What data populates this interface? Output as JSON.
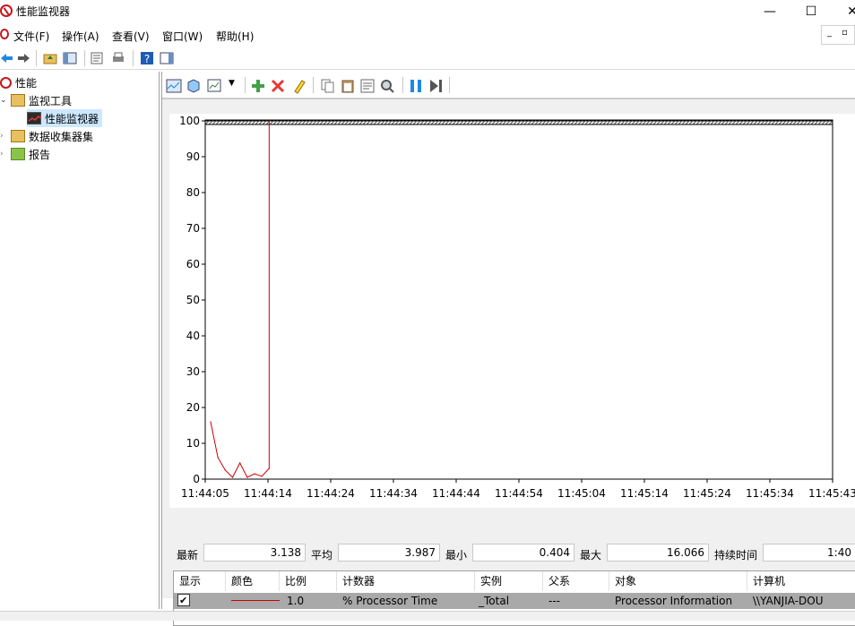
{
  "window": {
    "title": "性能监视器",
    "minimize": "—",
    "maximize": "☐",
    "close": "✕"
  },
  "menu": {
    "items": [
      "文件(F)",
      "操作(A)",
      "查看(V)",
      "窗口(W)",
      "帮助(H)"
    ]
  },
  "tree": {
    "items": [
      {
        "label": "性能",
        "icon": "performance-icon"
      },
      {
        "label": "监视工具",
        "icon": "folder-icon"
      },
      {
        "label": "性能监视器",
        "icon": "monitor-chart-icon"
      },
      {
        "label": "数据收集器集",
        "icon": "folder-icon"
      },
      {
        "label": "报告",
        "icon": "report-icon"
      }
    ]
  },
  "stats": {
    "last_label": "最新",
    "last_value": "3.138",
    "avg_label": "平均",
    "avg_value": "3.987",
    "min_label": "最小",
    "min_value": "0.404",
    "max_label": "最大",
    "max_value": "16.066",
    "duration_label": "持续时间",
    "duration_value": "1:40"
  },
  "table": {
    "headers": [
      "显示",
      "颜色",
      "比例",
      "计数器",
      "实例",
      "父系",
      "对象",
      "计算机"
    ],
    "rows": [
      {
        "show": "✔",
        "scale": "1.0",
        "counter": "% Processor Time",
        "instance": "_Total",
        "parent": "---",
        "object": "Processor Information",
        "computer": "\\\\YANJIA-DOU"
      }
    ]
  },
  "colors": {
    "line": "#cc0000",
    "selected_row": "#a9a9a9",
    "tree_selected": "#cce8ff"
  },
  "chart_data": {
    "type": "line",
    "ylim": [
      0,
      100
    ],
    "yticks": [
      0,
      10,
      20,
      30,
      40,
      50,
      60,
      70,
      80,
      90,
      100
    ],
    "xticks": [
      "11:44:05",
      "11:44:14",
      "11:44:24",
      "11:44:34",
      "11:44:44",
      "11:44:54",
      "11:45:04",
      "11:45:14",
      "11:45:24",
      "11:45:34",
      "11:45:43"
    ],
    "series": [
      {
        "values": [
          16,
          6,
          2.5,
          0.5,
          4.5,
          0.5,
          1.5,
          0.8,
          3,
          100
        ]
      }
    ]
  }
}
